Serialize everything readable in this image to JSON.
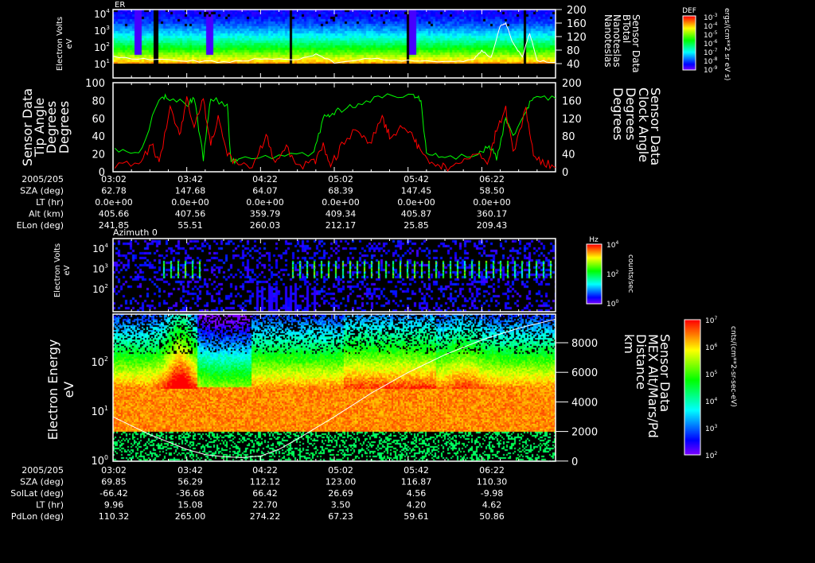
{
  "colors": {
    "background": "#000000",
    "axis": "#ffffff",
    "tip_angle": "#ff0000",
    "clock_angle": "#00ff00",
    "trace": "#ffffff"
  },
  "panel1": {
    "title": "ER",
    "ylabel": [
      "Electron Volts",
      "eV"
    ],
    "yticks": [
      {
        "b": "10",
        "e": "4"
      },
      {
        "b": "10",
        "e": "3"
      },
      {
        "b": "10",
        "e": "2"
      },
      {
        "b": "10",
        "e": "1"
      }
    ],
    "right_ticks": [
      "200",
      "160",
      "120",
      "80",
      "40"
    ],
    "right_label": [
      "Sensor Data",
      "BTotal",
      "Nanoteslas",
      "Nanoteslas"
    ],
    "colorbar": {
      "title": "DEF",
      "ticks": [
        {
          "b": "10",
          "e": "-3"
        },
        {
          "b": "10",
          "e": "-4"
        },
        {
          "b": "10",
          "e": "-5"
        },
        {
          "b": "10",
          "e": "-6"
        },
        {
          "b": "10",
          "e": "-7"
        },
        {
          "b": "10",
          "e": "-8"
        },
        {
          "b": "10",
          "e": "-9"
        }
      ],
      "units": "ergs/(cm**2 sr eV s)"
    }
  },
  "panel2": {
    "left_ticks": [
      "100",
      "80",
      "60",
      "40",
      "20",
      "0"
    ],
    "right_ticks": [
      "200",
      "160",
      "120",
      "80",
      "40",
      "0"
    ],
    "left_label": [
      "Sensor Data",
      "Tip Angle",
      "Degrees",
      "Degrees"
    ],
    "right_label": [
      "Sensor Data",
      "Clock Angle",
      "Degrees",
      "Degrees"
    ]
  },
  "ephem1": {
    "header": "2005/205",
    "times": [
      "03:02",
      "03:42",
      "04:22",
      "05:02",
      "05:42",
      "06:22"
    ],
    "rows": [
      {
        "label": "SZA (deg)",
        "values": [
          "62.78",
          "147.68",
          "64.07",
          "68.39",
          "147.45",
          "58.50"
        ]
      },
      {
        "label": "LT (hr)",
        "values": [
          "0.0e+00",
          "0.0e+00",
          "0.0e+00",
          "0.0e+00",
          "0.0e+00",
          "0.0e+00"
        ]
      },
      {
        "label": "Alt (km)",
        "values": [
          "405.66",
          "407.56",
          "359.79",
          "409.34",
          "405.87",
          "360.17"
        ]
      },
      {
        "label": "ELon (deg)",
        "values": [
          "241.85",
          "55.51",
          "260.03",
          "212.17",
          "25.85",
          "209.43"
        ]
      }
    ]
  },
  "panel3": {
    "title": "Azimuth 0",
    "ylabel": [
      "Electron Volts",
      "eV"
    ],
    "yticks": [
      {
        "b": "10",
        "e": "4"
      },
      {
        "b": "10",
        "e": "3"
      },
      {
        "b": "10",
        "e": "2"
      }
    ],
    "colorbar": {
      "title": "Hz",
      "ticks": [
        {
          "b": "10",
          "e": "4"
        },
        {
          "b": "10",
          "e": "2"
        },
        {
          "b": "10",
          "e": "0"
        }
      ],
      "units": "counts/sec"
    }
  },
  "panel4": {
    "ylabel": [
      "Electron Energy",
      "eV"
    ],
    "yticks": [
      {
        "b": "10",
        "e": "2"
      },
      {
        "b": "10",
        "e": "1"
      },
      {
        "b": "10",
        "e": "0"
      }
    ],
    "right_ticks": [
      "8000",
      "6000",
      "4000",
      "2000",
      "0"
    ],
    "right_label": [
      "Sensor Data",
      "MEX Alt/Mars/Pd",
      "Distance",
      "km"
    ],
    "colorbar": {
      "ticks": [
        {
          "b": "10",
          "e": "7"
        },
        {
          "b": "10",
          "e": "6"
        },
        {
          "b": "10",
          "e": "5"
        },
        {
          "b": "10",
          "e": "4"
        },
        {
          "b": "10",
          "e": "3"
        },
        {
          "b": "10",
          "e": "2"
        }
      ],
      "units": "cnts/(cm**2-sr-sec-eV)"
    }
  },
  "ephem2": {
    "header": "2005/205",
    "times": [
      "03:02",
      "03:42",
      "04:22",
      "05:02",
      "05:42",
      "06:22"
    ],
    "rows": [
      {
        "label": "SZA (deg)",
        "values": [
          "69.85",
          "56.29",
          "112.12",
          "123.00",
          "116.87",
          "110.30"
        ]
      },
      {
        "label": "SolLat (deg)",
        "values": [
          "-66.42",
          "-36.68",
          "66.42",
          "26.69",
          "4.56",
          "-9.98"
        ]
      },
      {
        "label": "LT (hr)",
        "values": [
          "9.96",
          "15.08",
          "22.70",
          "3.50",
          "4.20",
          "4.62"
        ]
      },
      {
        "label": "PdLon (deg)",
        "values": [
          "110.32",
          "265.00",
          "274.22",
          "67.23",
          "59.61",
          "50.86"
        ]
      }
    ]
  },
  "chart_data": [
    {
      "type": "heatmap",
      "title": "ER",
      "ylabel": "Electron Volts (eV)",
      "ylim": [
        10,
        20000
      ],
      "yscale": "log",
      "colorbar": "DEF ergs/(cm**2 sr eV s)",
      "clim": [
        1e-09,
        0.001
      ],
      "overlay": {
        "type": "line",
        "name": "BTotal (nT)",
        "ylim": [
          0,
          200
        ],
        "x_minutes_after_0302": [
          0,
          20,
          40,
          60,
          80,
          100,
          110,
          120,
          140,
          160,
          180,
          195,
          200,
          205,
          210,
          213,
          217,
          222,
          226,
          230,
          240
        ],
        "values": [
          60,
          55,
          50,
          45,
          55,
          50,
          70,
          45,
          55,
          50,
          45,
          50,
          80,
          60,
          150,
          160,
          100,
          60,
          130,
          50,
          45
        ]
      }
    },
    {
      "type": "line",
      "xlim_minutes_after_0302": [
        0,
        240
      ],
      "series": [
        {
          "name": "Tip Angle (deg)",
          "axis": "left",
          "ylim": [
            0,
            100
          ],
          "x": [
            1,
            14,
            21,
            25,
            31,
            36,
            40,
            44,
            49,
            53,
            57,
            62,
            68,
            77,
            83,
            88,
            94,
            100,
            109,
            114,
            118,
            124,
            133,
            139,
            146,
            150,
            157,
            163,
            167,
            174,
            180,
            189,
            198,
            204,
            208,
            213,
            217,
            224,
            228,
            234,
            240
          ],
          "values": [
            5,
            10,
            30,
            10,
            70,
            40,
            85,
            50,
            80,
            30,
            60,
            20,
            5,
            10,
            40,
            10,
            30,
            5,
            10,
            30,
            5,
            30,
            50,
            30,
            60,
            40,
            50,
            40,
            20,
            10,
            5,
            10,
            20,
            10,
            50,
            70,
            20,
            70,
            20,
            10,
            5
          ]
        },
        {
          "name": "Clock Angle (deg)",
          "axis": "right",
          "ylim": [
            0,
            200
          ],
          "x": [
            1,
            14,
            25,
            29,
            40,
            44,
            49,
            53,
            62,
            64,
            68,
            90,
            109,
            114,
            118,
            124,
            133,
            146,
            163,
            167,
            170,
            180,
            198,
            204,
            208,
            213,
            217,
            224,
            228,
            240
          ],
          "values": [
            50,
            40,
            160,
            170,
            150,
            165,
            30,
            165,
            150,
            20,
            30,
            35,
            40,
            120,
            130,
            140,
            150,
            170,
            170,
            160,
            40,
            30,
            40,
            60,
            30,
            120,
            80,
            140,
            170,
            165
          ]
        }
      ]
    },
    {
      "type": "heatmap",
      "title": "Azimuth 0",
      "ylabel": "Electron Volts (eV)",
      "yscale": "log",
      "colorbar": "Hz counts/sec",
      "clim": [
        1,
        10000
      ]
    },
    {
      "type": "heatmap",
      "ylabel": "Electron Energy (eV)",
      "ylim": [
        1,
        1000
      ],
      "yscale": "log",
      "colorbar": "cnts/(cm**2-sr-sec-eV)",
      "clim": [
        100,
        10000000
      ],
      "overlay": {
        "type": "line",
        "name": "MEX Alt/Mars/Pd Distance (km)",
        "ylim": [
          0,
          9600
        ],
        "x_minutes_after_0302": [
          0,
          20,
          40,
          50,
          60,
          70,
          80,
          90,
          100,
          120,
          140,
          160,
          180,
          200,
          220,
          240
        ],
        "values": [
          3000,
          1800,
          800,
          450,
          300,
          250,
          350,
          800,
          1500,
          3000,
          4600,
          6000,
          7200,
          8200,
          9000,
          9600
        ]
      }
    }
  ]
}
